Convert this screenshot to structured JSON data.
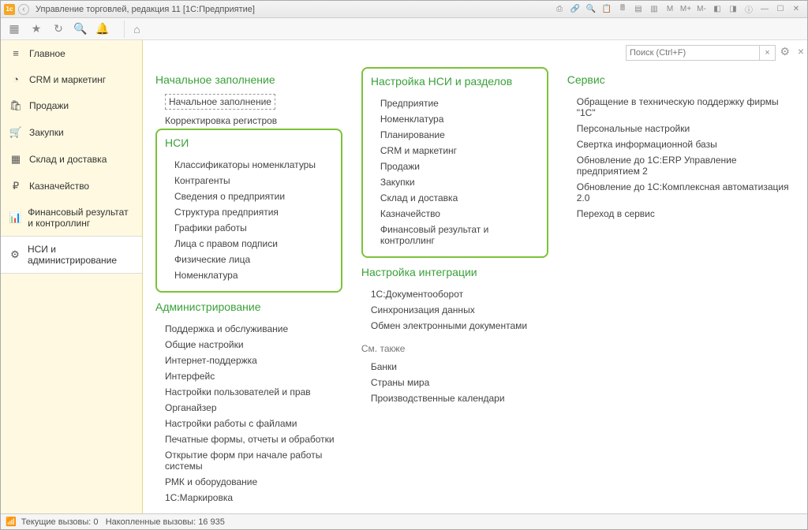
{
  "title": "Управление торговлей, редакция 11  [1С:Предприятие]",
  "toolbar_buttons": [
    "M",
    "M+",
    "M-"
  ],
  "search": {
    "placeholder": "Поиск (Ctrl+F)"
  },
  "sidebar": {
    "items": [
      {
        "label": "Главное",
        "icon": "≡"
      },
      {
        "label": "CRM и маркетинг",
        "icon": "◔"
      },
      {
        "label": "Продажи",
        "icon": "🛍"
      },
      {
        "label": "Закупки",
        "icon": "🛒"
      },
      {
        "label": "Склад и доставка",
        "icon": "▦"
      },
      {
        "label": "Казначейство",
        "icon": "₽"
      },
      {
        "label": "Финансовый результат и контроллинг",
        "icon": "📊"
      },
      {
        "label": "НСИ и администрирование",
        "icon": "⚙"
      }
    ]
  },
  "col1": {
    "group1": {
      "title": "Начальное заполнение",
      "items": [
        "Начальное заполнение",
        "Корректировка регистров"
      ]
    },
    "group2": {
      "title": "НСИ",
      "items": [
        "Классификаторы номенклатуры",
        "Контрагенты",
        "Сведения о предприятии",
        "Структура предприятия",
        "Графики работы",
        "Лица с правом подписи",
        "Физические лица",
        "Номенклатура"
      ]
    },
    "group3": {
      "title": "Администрирование",
      "items": [
        "Поддержка и обслуживание",
        "Общие настройки",
        "Интернет-поддержка",
        "Интерфейс",
        "Настройки пользователей и прав",
        "Органайзер",
        "Настройки работы с файлами",
        "Печатные формы, отчеты и обработки",
        "Открытие форм при начале работы системы",
        "РМК и оборудование",
        "1С:Маркировка"
      ]
    }
  },
  "col2": {
    "group1": {
      "title": "Настройка НСИ и разделов",
      "items": [
        "Предприятие",
        "Номенклатура",
        "Планирование",
        "CRM и маркетинг",
        "Продажи",
        "Закупки",
        "Склад и доставка",
        "Казначейство",
        "Финансовый результат и контроллинг"
      ]
    },
    "group2": {
      "title": "Настройка интеграции",
      "items": [
        "1С:Документооборот",
        "Синхронизация данных",
        "Обмен электронными документами"
      ]
    },
    "group3": {
      "title": "См. также",
      "items": [
        "Банки",
        "Страны мира",
        "Производственные календари"
      ]
    }
  },
  "col3": {
    "group1": {
      "title": "Сервис",
      "items": [
        "Обращение в техническую поддержку фирмы \"1С\"",
        "Персональные настройки",
        "Свертка информационной базы",
        "Обновление до 1С:ERP Управление предприятием 2",
        "Обновление до 1С:Комплексная автоматизация 2.0",
        "Переход в сервис"
      ]
    }
  },
  "status": {
    "current_label": "Текущие вызовы:",
    "current_value": "0",
    "accum_label": "Накопленные вызовы:",
    "accum_value": "16 935"
  }
}
